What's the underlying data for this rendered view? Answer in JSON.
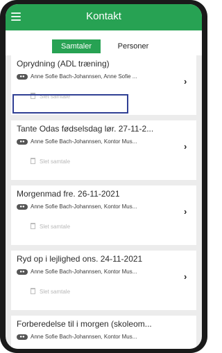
{
  "app": {
    "title": "Kontakt",
    "colors": {
      "header": "#27a253",
      "active_tab": "#27a253",
      "highlight_border": "#2f3f94"
    }
  },
  "tabs": [
    {
      "label": "Samtaler",
      "active": true
    },
    {
      "label": "Personer",
      "active": false
    }
  ],
  "conversations": [
    {
      "title": "Oprydning (ADL træning)",
      "participants": "Anne Sofie Bach-Johannsen, Anne Sofie ...",
      "meta": "",
      "action": "Slet samtale"
    },
    {
      "title": "Tante Odas fødselsdag lør. 27-11-2...",
      "participants": "Anne Sofie Bach-Johannsen, Kontor Mus...",
      "meta": "",
      "action": "Slet samtale"
    },
    {
      "title": "Morgenmad fre. 26-11-2021",
      "participants": "Anne Sofie Bach-Johannsen, Kontor Mus...",
      "meta": "",
      "action": "Slet samtale"
    },
    {
      "title": "Ryd op i lejlighed ons. 24-11-2021",
      "participants": "Anne Sofie Bach-Johannsen, Kontor Mus...",
      "meta": "",
      "action": "Slet samtale"
    },
    {
      "title": "Forberedelse til i morgen (skoleom...",
      "participants": "Anne Sofie Bach-Johannsen, Kontor Mus...",
      "meta": "",
      "action": ""
    }
  ],
  "icons": {
    "menu": "hamburger-icon",
    "delete": "trash-icon",
    "open": "chevron-right-icon",
    "group": "group-badge-icon"
  }
}
